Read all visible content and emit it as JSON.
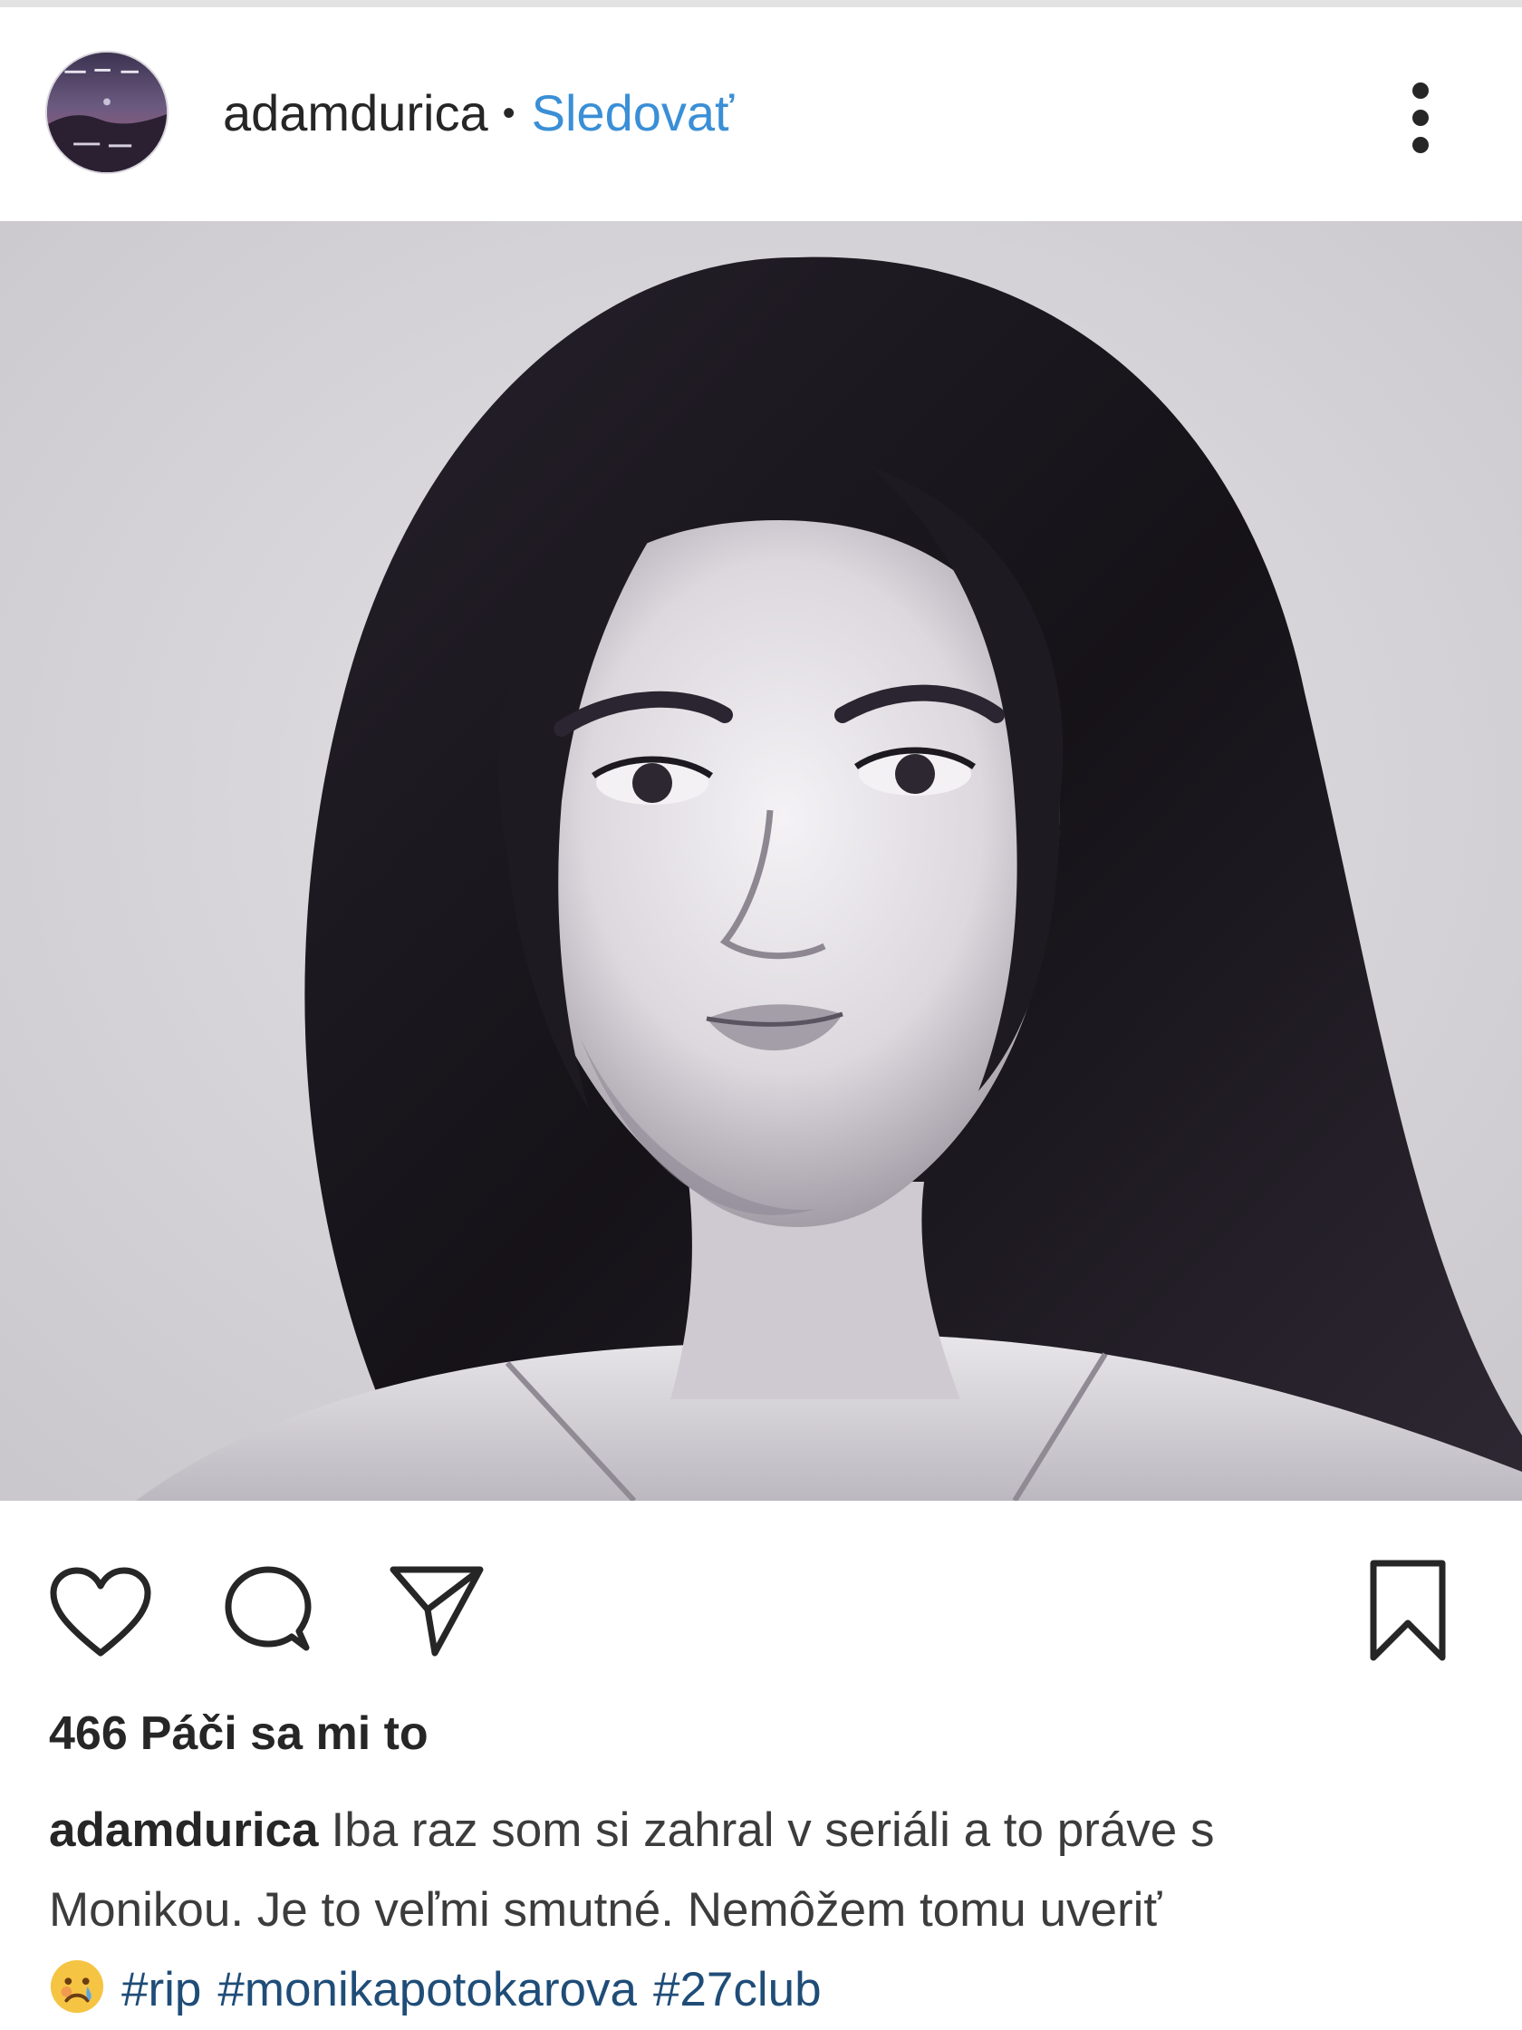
{
  "header": {
    "username": "adamdurica",
    "separator": "•",
    "follow_label": "Sledovať"
  },
  "icons": {
    "avatar": "profile-avatar",
    "more": "more-vertical-icon",
    "like": "heart-icon",
    "comment": "comment-bubble-icon",
    "share": "paper-plane-icon",
    "save": "bookmark-icon",
    "emoji": "crying-face-emoji"
  },
  "colors": {
    "follow_link": "#3a8fd6",
    "hashtag": "#1f4d78",
    "text": "#262626"
  },
  "likes": {
    "count": "466",
    "label": "Páči sa mi to"
  },
  "caption": {
    "username": "adamdurica",
    "line1": "Iba raz som si zahral v seriáli a to práve s",
    "line2": "Monikou. Je to veľmi smutné. Nemôžem tomu uveriť",
    "hashtags": [
      "#rip",
      "#monikapotokarova",
      "#27club"
    ]
  }
}
